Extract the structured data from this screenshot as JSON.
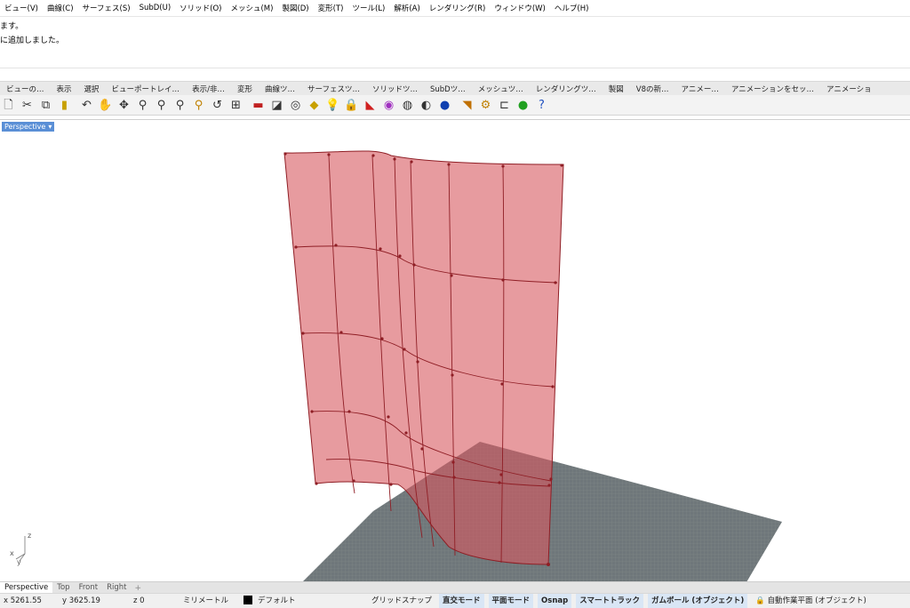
{
  "menubar": {
    "items": [
      "ビュー(V)",
      "曲線(C)",
      "サーフェス(S)",
      "SubD(U)",
      "ソリッド(O)",
      "メッシュ(M)",
      "製図(D)",
      "変形(T)",
      "ツール(L)",
      "解析(A)",
      "レンダリング(R)",
      "ウィンドウ(W)",
      "ヘルプ(H)"
    ]
  },
  "command_history": {
    "line1": "ます。",
    "line2": "に追加しました。"
  },
  "toolbar_tabs": {
    "items": [
      "ビューの…",
      "表示",
      "選択",
      "ビューポートレイ…",
      "表示/非…",
      "変形",
      "曲線ツ…",
      "サーフェスツ…",
      "ソリッドツ…",
      "SubDツ…",
      "メッシュツ…",
      "レンダリングツ…",
      "製図",
      "V8の新…",
      "アニメー…",
      "アニメーションをセッ…",
      "アニメーショ"
    ]
  },
  "toolbar": {
    "icons": [
      "new-file-icon",
      "cut-icon",
      "copy-icon",
      "paste-icon",
      "undo-icon",
      "pan-hand-icon",
      "rotate-view-icon",
      "zoom-icon",
      "zoom-window-icon",
      "zoom-extents-icon",
      "zoom-selected-icon",
      "undo-view-icon",
      "four-viewports-icon",
      "car-icon",
      "camera-icon",
      "target-icon",
      "layer-icon",
      "light-bulb-icon",
      "lock-icon",
      "material-icon",
      "color-wheel-icon",
      "globe-icon",
      "render-icon",
      "sphere-icon",
      "gumball-icon",
      "settings-icon",
      "dimension-icon",
      "green-globe-icon",
      "help-icon"
    ]
  },
  "viewport": {
    "label": "Perspective",
    "axes": {
      "z": "z",
      "x": "x",
      "y": "y"
    }
  },
  "viewport_tabs": {
    "items": [
      "Perspective",
      "Top",
      "Front",
      "Right"
    ],
    "active": "Perspective",
    "add": "+"
  },
  "statusbar": {
    "x": "x 5261.55",
    "y": "y 3625.19",
    "z": "z 0",
    "units": "ミリメートル",
    "layer": "デフォルト",
    "grid_snap": "グリッドスナップ",
    "ortho": "直交モード",
    "planar": "平面モード",
    "osnap": "Osnap",
    "smarttrack": "スマートトラック",
    "gumball": "ガムボール (オブジェクト)",
    "auto_cplane": "自動作業平面 (オブジェクト)"
  },
  "colors": {
    "surface_fill": "#d7595f",
    "surface_edge": "#8f1e25",
    "grid_plane": "#6b7375",
    "viewport_label": "#5a8fd6"
  }
}
